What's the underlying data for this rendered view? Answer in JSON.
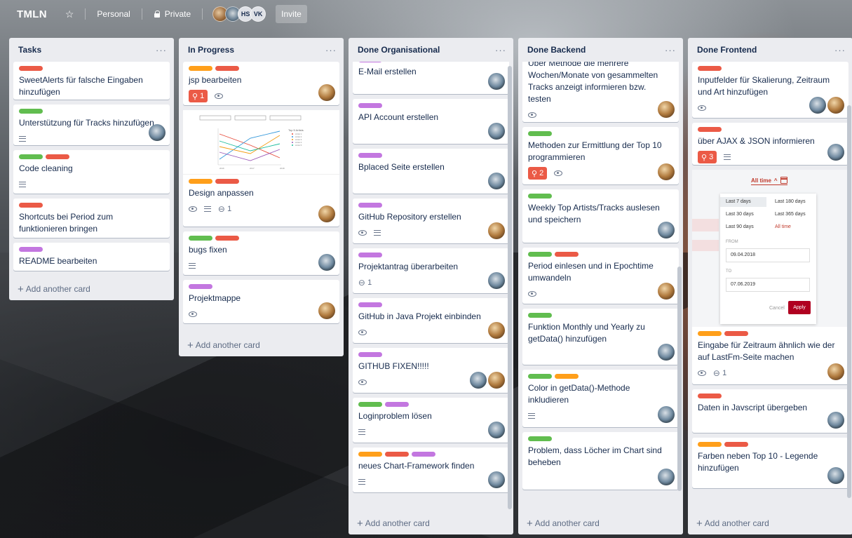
{
  "board": {
    "title": "TMLN",
    "team": "Personal",
    "visibility": "Private",
    "members": [
      "HS",
      "VK"
    ],
    "invite_label": "Invite"
  },
  "colors": {
    "green": "#61bd4f",
    "red": "#eb5a46",
    "orange": "#ff9f1a",
    "purple": "#c377e0"
  },
  "add_card_label": "Add another card",
  "lists": [
    {
      "title": "Tasks",
      "cards": [
        {
          "labels": [
            "red"
          ],
          "title": "SweetAlerts für falsche Eingaben hinzufügen",
          "badges": [],
          "avatars": []
        },
        {
          "labels": [
            "green"
          ],
          "title": "Unterstützung für Tracks hinzufügen",
          "badges": [
            "description"
          ],
          "avatars": [
            "p"
          ]
        },
        {
          "labels": [
            "green",
            "red"
          ],
          "title": "Code cleaning",
          "badges": [
            "description"
          ],
          "avatars": []
        },
        {
          "labels": [
            "red"
          ],
          "title": "Shortcuts bei Period zum funktionieren bringen",
          "badges": [],
          "avatars": []
        },
        {
          "labels": [
            "purple"
          ],
          "title": "README bearbeiten",
          "badges": [],
          "avatars": []
        }
      ]
    },
    {
      "title": "In Progress",
      "cards": [
        {
          "labels": [
            "orange",
            "red"
          ],
          "title": "jsp bearbeiten",
          "pin": "1",
          "badges": [
            "watch"
          ],
          "avatars": [
            "c"
          ]
        },
        {
          "labels": [
            "orange",
            "red"
          ],
          "title": "Design anpassen",
          "badges": [
            "watch",
            "description"
          ],
          "attachments": "1",
          "avatars": [
            "c"
          ],
          "cover": "chart"
        },
        {
          "labels": [
            "green",
            "red"
          ],
          "title": "bugs fixen",
          "badges": [
            "description"
          ],
          "avatars": [
            "p"
          ]
        },
        {
          "labels": [
            "purple"
          ],
          "title": "Projektmappe",
          "badges": [
            "watch"
          ],
          "avatars": [
            "c"
          ]
        }
      ]
    },
    {
      "title": "Done Organisational",
      "cards": [
        {
          "labels": [
            "purple"
          ],
          "title": "E-Mail erstellen",
          "badges": [],
          "avatars": [
            "p"
          ],
          "clipped": true
        },
        {
          "labels": [
            "purple"
          ],
          "title": "API Account erstellen",
          "badges": [],
          "avatars": [
            "p"
          ]
        },
        {
          "labels": [
            "purple"
          ],
          "title": "Bplaced Seite erstellen",
          "badges": [],
          "avatars": [
            "p"
          ]
        },
        {
          "labels": [
            "purple"
          ],
          "title": "GitHub Repository erstellen",
          "badges": [
            "watch",
            "description"
          ],
          "avatars": [
            "c"
          ]
        },
        {
          "labels": [
            "purple"
          ],
          "title": "Projektantrag überarbeiten",
          "attachments": "1",
          "badges": [],
          "avatars": [
            "p"
          ]
        },
        {
          "labels": [
            "purple"
          ],
          "title": "GitHub in Java Projekt einbinden",
          "badges": [
            "watch"
          ],
          "avatars": [
            "c"
          ]
        },
        {
          "labels": [
            "purple"
          ],
          "title": "GITHUB FIXEN!!!!!",
          "badges": [
            "watch"
          ],
          "avatars": [
            "p",
            "c"
          ]
        },
        {
          "labels": [
            "green",
            "purple"
          ],
          "title": "Loginproblem lösen",
          "badges": [
            "description"
          ],
          "avatars": [
            "p"
          ]
        },
        {
          "labels": [
            "orange",
            "red",
            "purple"
          ],
          "title": "neues Chart-Framework finden",
          "badges": [
            "description"
          ],
          "avatars": [
            "p"
          ]
        }
      ]
    },
    {
      "title": "Done Backend",
      "cards": [
        {
          "labels": [],
          "title": "Über Methode die mehrere Wochen/Monate von gesammelten Tracks anzeigt informieren bzw. testen",
          "badges": [
            "watch"
          ],
          "avatars": [
            "c"
          ],
          "clipped": true
        },
        {
          "labels": [
            "green"
          ],
          "title": "Methoden zur Ermittlung der Top 10 programmieren",
          "pin": "2",
          "badges": [
            "watch"
          ],
          "avatars": [
            "c"
          ]
        },
        {
          "labels": [
            "green"
          ],
          "title": "Weekly Top Artists/Tracks auslesen und speichern",
          "badges": [],
          "avatars": [
            "p"
          ]
        },
        {
          "labels": [
            "green",
            "red"
          ],
          "title": "Period einlesen und in Epochtime umwandeln",
          "badges": [
            "watch"
          ],
          "avatars": [
            "c"
          ]
        },
        {
          "labels": [
            "green"
          ],
          "title": "Funktion Monthly und Yearly zu getData() hinzufügen",
          "badges": [],
          "avatars": [
            "p"
          ]
        },
        {
          "labels": [
            "green",
            "orange"
          ],
          "title": "Color in getData()-Methode inkludieren",
          "badges": [
            "description"
          ],
          "avatars": [
            "p"
          ]
        },
        {
          "labels": [
            "green"
          ],
          "title": "Problem, dass Löcher im Chart sind beheben",
          "badges": [],
          "avatars": [
            "p"
          ]
        }
      ]
    },
    {
      "title": "Done Frontend",
      "cards": [
        {
          "labels": [
            "red"
          ],
          "title": "Inputfelder für Skalierung, Zeitraum und Art hinzufügen",
          "badges": [
            "watch"
          ],
          "avatars": [
            "p",
            "c"
          ]
        },
        {
          "labels": [
            "red"
          ],
          "title": "über AJAX & JSON informieren",
          "pin": "3",
          "badges": [
            "description"
          ],
          "avatars": [
            "p"
          ]
        },
        {
          "labels": [
            "orange",
            "red"
          ],
          "title": "Eingabe für Zeitraum ähnlich wie der auf LastFm-Seite machen",
          "badges": [
            "watch"
          ],
          "attachments": "1",
          "avatars": [
            "c"
          ],
          "cover": "datepicker"
        },
        {
          "labels": [
            "red"
          ],
          "title": "Daten in Javscript übergeben",
          "badges": [],
          "avatars": [
            "p"
          ]
        },
        {
          "labels": [
            "orange",
            "red"
          ],
          "title": "Farben neben Top 10 - Legende hinzufügen",
          "badges": [],
          "avatars": [
            "p"
          ]
        }
      ]
    }
  ],
  "datepicker": {
    "head": "All time",
    "presets": [
      [
        "Last 7 days",
        "Last 180 days"
      ],
      [
        "Last 30 days",
        "Last 365 days"
      ],
      [
        "Last 90 days",
        "All time"
      ]
    ],
    "from_label": "FROM",
    "from_value": "09.04.2018",
    "to_label": "TO",
    "to_value": "07.06.2019",
    "cancel": "Cancel",
    "apply": "Apply"
  },
  "chart_thumb": {
    "legend_title": "Top 5 Artists",
    "legend_items": [
      "Artist 1",
      "Artist 2",
      "Artist 3",
      "Artist 4",
      "Artist 5"
    ],
    "x_ticks": [
      "2016",
      "2017",
      "2018"
    ]
  }
}
